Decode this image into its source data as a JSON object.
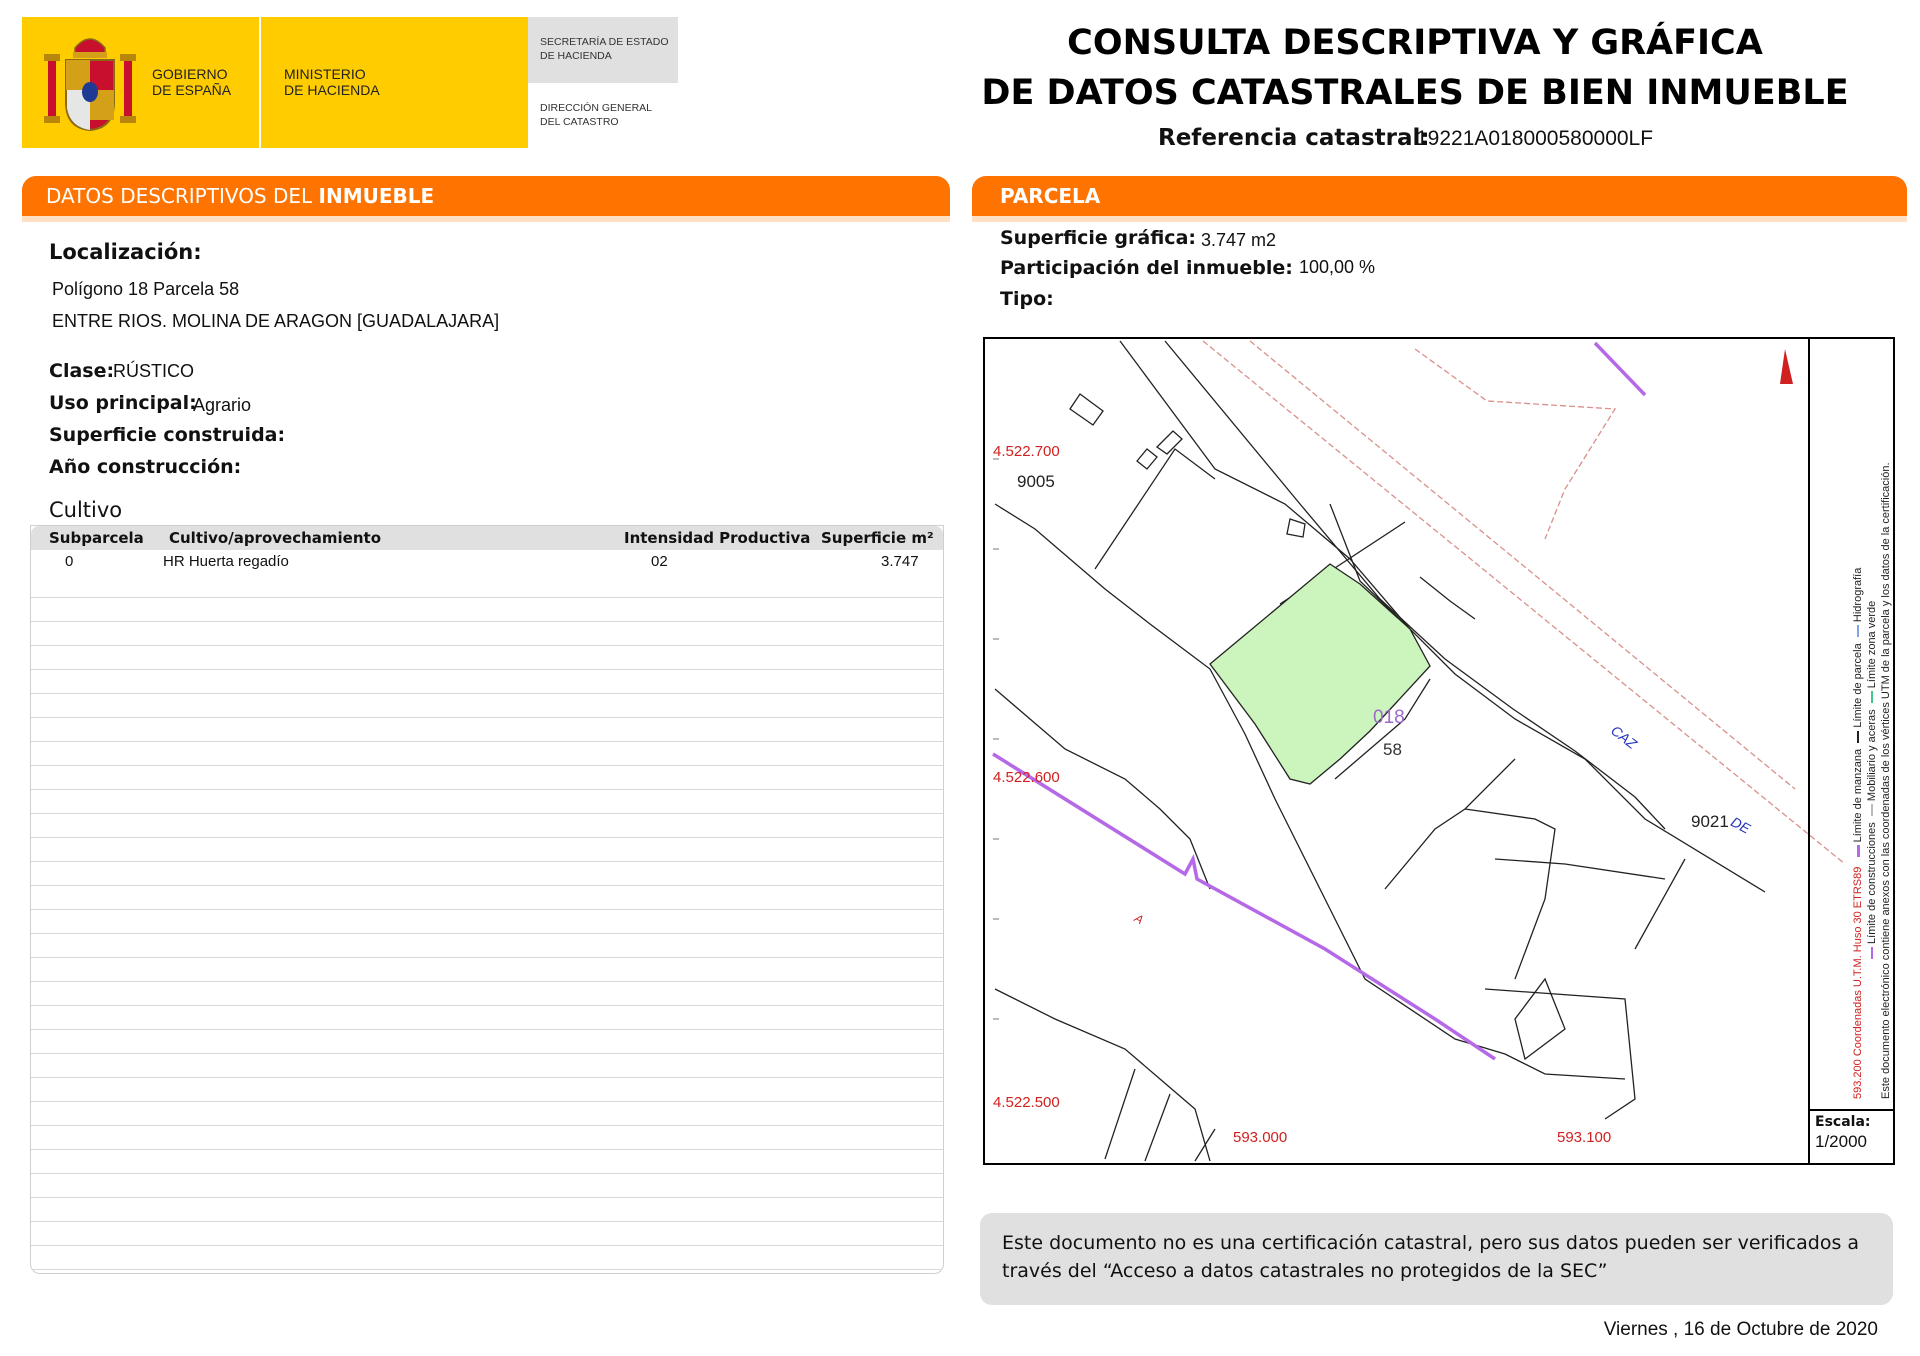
{
  "header": {
    "gov_line1": "GOBIERNO",
    "gov_line2": "DE ESPAÑA",
    "ministry_line1": "MINISTERIO",
    "ministry_line2": "DE HACIENDA",
    "secretaria_line1": "SECRETARÍA DE ESTADO",
    "secretaria_line2": "DE HACIENDA",
    "direccion_line1": "DIRECCIÓN GENERAL",
    "direccion_line2": "DEL CATASTRO",
    "brand_yellow": "#ffcc00",
    "brand_red": "#c8102e"
  },
  "title": {
    "line1": "CONSULTA DESCRIPTIVA Y GRÁFICA",
    "line2": "DE DATOS CATASTRALES DE BIEN INMUEBLE",
    "ref_label": "Referencia catastral:",
    "ref_value": "19221A018000580000LF"
  },
  "descriptivos": {
    "header_prefix": "DATOS DESCRIPTIVOS DEL ",
    "header_bold": "INMUEBLE",
    "localizacion_label": "Localización:",
    "loc_line1": "Polígono 18 Parcela 58",
    "loc_line2": "ENTRE RIOS. MOLINA DE ARAGON [GUADALAJARA]",
    "clase_label": "Clase:",
    "clase_value": "RÚSTICO",
    "uso_label": "Uso principal:",
    "uso_value": "Agrario",
    "superficie_label": "Superficie construida:",
    "anio_label": "Año construcción:"
  },
  "cultivo": {
    "title": "Cultivo",
    "columns": [
      "Subparcela",
      "Cultivo/aprovechamiento",
      "Intensidad Productiva",
      "Superficie m²"
    ],
    "rows": [
      [
        "0",
        "HR Huerta regadío",
        "02",
        "3.747"
      ]
    ]
  },
  "parcela": {
    "header": "PARCELA",
    "superficie_label": "Superficie gráfica:",
    "superficie_value": "3.747 m2",
    "participacion_label": "Participación del inmueble:",
    "participacion_value": "100,00 %",
    "tipo_label": "Tipo:"
  },
  "map": {
    "coord_y1": "4.522.700",
    "coord_y2": "4.522.600",
    "coord_y3": "4.522.500",
    "coord_x1": "593.000",
    "coord_x2": "593.100",
    "label_9005": "9005",
    "label_9021": "9021",
    "label_caz": "CAZ",
    "label_de": "DE",
    "label_a": "A",
    "poligono": "018",
    "parcela": "58",
    "legend_manzana": "Límite de manzana",
    "legend_parcela": "Límite de parcela",
    "legend_hidrografia": "Hidrografía",
    "legend_construcciones": "Límite de construcciones",
    "legend_mobiliario": "Mobiliario y aceras",
    "legend_zona_verde": "Límite zona verde",
    "legend_coords": "593.200 Coordenadas U.T.M. Huso 30 ETRS89",
    "legend_note": "Este documento electrónico contiene anexos con las coordenadas de los vértices UTM de la parcela y los datos de la certificación.",
    "escala_label": "Escala:",
    "escala_value": "1/2000",
    "parcel_fill": "#ccf5bd",
    "coord_color": "#d02020"
  },
  "note": {
    "text": "Este documento no es una certificación catastral, pero sus datos pueden ser verificados a través del “Acceso a datos catastrales no protegidos de la SEC”"
  },
  "footer": {
    "date": "Viernes , 16 de Octubre de 2020"
  }
}
